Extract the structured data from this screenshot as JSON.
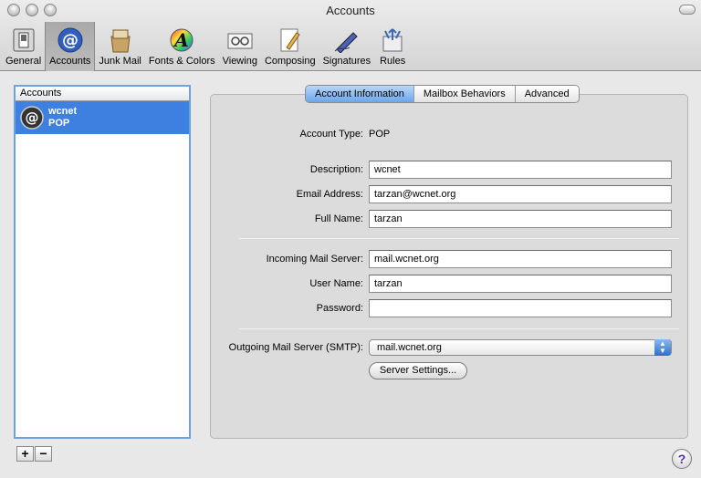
{
  "window": {
    "title": "Accounts"
  },
  "toolbar": {
    "items": [
      {
        "label": "General",
        "icon": "switch-icon"
      },
      {
        "label": "Accounts",
        "icon": "at-sign-icon",
        "selected": true
      },
      {
        "label": "Junk Mail",
        "icon": "junk-bag-icon"
      },
      {
        "label": "Fonts & Colors",
        "icon": "font-color-icon"
      },
      {
        "label": "Viewing",
        "icon": "viewing-icon"
      },
      {
        "label": "Composing",
        "icon": "pencil-paper-icon"
      },
      {
        "label": "Signatures",
        "icon": "fountain-pen-icon"
      },
      {
        "label": "Rules",
        "icon": "rules-arrows-icon"
      }
    ]
  },
  "accounts": {
    "header": "Accounts",
    "items": [
      {
        "name": "wcnet",
        "type": "POP"
      }
    ],
    "add_label": "+",
    "remove_label": "−"
  },
  "tabs": [
    {
      "label": "Account Information",
      "active": true
    },
    {
      "label": "Mailbox Behaviors",
      "active": false
    },
    {
      "label": "Advanced",
      "active": false
    }
  ],
  "form": {
    "account_type_label": "Account Type:",
    "account_type_value": "POP",
    "description_label": "Description:",
    "description_value": "wcnet",
    "email_label": "Email Address:",
    "email_value": "tarzan@wcnet.org",
    "fullname_label": "Full Name:",
    "fullname_value": "tarzan",
    "incoming_label": "Incoming Mail Server:",
    "incoming_value": "mail.wcnet.org",
    "username_label": "User Name:",
    "username_value": "tarzan",
    "password_label": "Password:",
    "password_value": "",
    "outgoing_label": "Outgoing Mail Server (SMTP):",
    "outgoing_value": "mail.wcnet.org",
    "server_settings_label": "Server Settings..."
  },
  "help_label": "?",
  "colors": {
    "selection": "#3d80df",
    "active_tab": "#6aa6ec"
  }
}
